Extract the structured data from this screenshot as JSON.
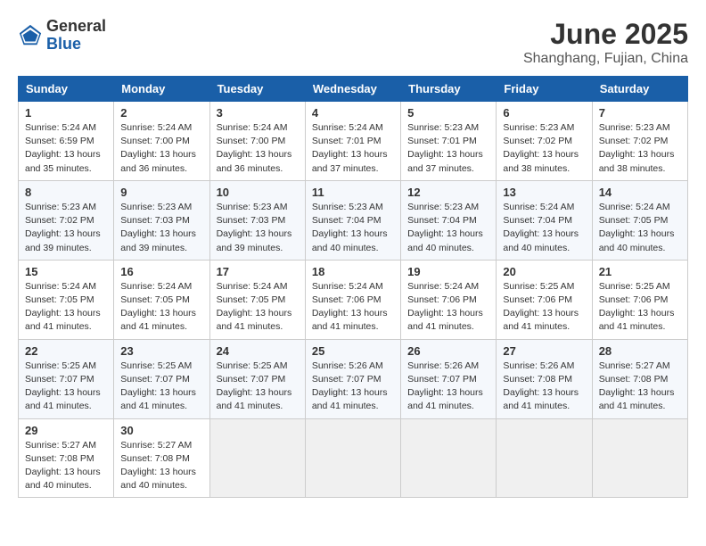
{
  "header": {
    "logo_general": "General",
    "logo_blue": "Blue",
    "month_title": "June 2025",
    "location": "Shanghang, Fujian, China"
  },
  "weekdays": [
    "Sunday",
    "Monday",
    "Tuesday",
    "Wednesday",
    "Thursday",
    "Friday",
    "Saturday"
  ],
  "weeks": [
    [
      {
        "day": "1",
        "sunrise": "5:24 AM",
        "sunset": "6:59 PM",
        "daylight": "13 hours and 35 minutes."
      },
      {
        "day": "2",
        "sunrise": "5:24 AM",
        "sunset": "7:00 PM",
        "daylight": "13 hours and 36 minutes."
      },
      {
        "day": "3",
        "sunrise": "5:24 AM",
        "sunset": "7:00 PM",
        "daylight": "13 hours and 36 minutes."
      },
      {
        "day": "4",
        "sunrise": "5:24 AM",
        "sunset": "7:01 PM",
        "daylight": "13 hours and 37 minutes."
      },
      {
        "day": "5",
        "sunrise": "5:23 AM",
        "sunset": "7:01 PM",
        "daylight": "13 hours and 37 minutes."
      },
      {
        "day": "6",
        "sunrise": "5:23 AM",
        "sunset": "7:02 PM",
        "daylight": "13 hours and 38 minutes."
      },
      {
        "day": "7",
        "sunrise": "5:23 AM",
        "sunset": "7:02 PM",
        "daylight": "13 hours and 38 minutes."
      }
    ],
    [
      {
        "day": "8",
        "sunrise": "5:23 AM",
        "sunset": "7:02 PM",
        "daylight": "13 hours and 39 minutes."
      },
      {
        "day": "9",
        "sunrise": "5:23 AM",
        "sunset": "7:03 PM",
        "daylight": "13 hours and 39 minutes."
      },
      {
        "day": "10",
        "sunrise": "5:23 AM",
        "sunset": "7:03 PM",
        "daylight": "13 hours and 39 minutes."
      },
      {
        "day": "11",
        "sunrise": "5:23 AM",
        "sunset": "7:04 PM",
        "daylight": "13 hours and 40 minutes."
      },
      {
        "day": "12",
        "sunrise": "5:23 AM",
        "sunset": "7:04 PM",
        "daylight": "13 hours and 40 minutes."
      },
      {
        "day": "13",
        "sunrise": "5:24 AM",
        "sunset": "7:04 PM",
        "daylight": "13 hours and 40 minutes."
      },
      {
        "day": "14",
        "sunrise": "5:24 AM",
        "sunset": "7:05 PM",
        "daylight": "13 hours and 40 minutes."
      }
    ],
    [
      {
        "day": "15",
        "sunrise": "5:24 AM",
        "sunset": "7:05 PM",
        "daylight": "13 hours and 41 minutes."
      },
      {
        "day": "16",
        "sunrise": "5:24 AM",
        "sunset": "7:05 PM",
        "daylight": "13 hours and 41 minutes."
      },
      {
        "day": "17",
        "sunrise": "5:24 AM",
        "sunset": "7:05 PM",
        "daylight": "13 hours and 41 minutes."
      },
      {
        "day": "18",
        "sunrise": "5:24 AM",
        "sunset": "7:06 PM",
        "daylight": "13 hours and 41 minutes."
      },
      {
        "day": "19",
        "sunrise": "5:24 AM",
        "sunset": "7:06 PM",
        "daylight": "13 hours and 41 minutes."
      },
      {
        "day": "20",
        "sunrise": "5:25 AM",
        "sunset": "7:06 PM",
        "daylight": "13 hours and 41 minutes."
      },
      {
        "day": "21",
        "sunrise": "5:25 AM",
        "sunset": "7:06 PM",
        "daylight": "13 hours and 41 minutes."
      }
    ],
    [
      {
        "day": "22",
        "sunrise": "5:25 AM",
        "sunset": "7:07 PM",
        "daylight": "13 hours and 41 minutes."
      },
      {
        "day": "23",
        "sunrise": "5:25 AM",
        "sunset": "7:07 PM",
        "daylight": "13 hours and 41 minutes."
      },
      {
        "day": "24",
        "sunrise": "5:25 AM",
        "sunset": "7:07 PM",
        "daylight": "13 hours and 41 minutes."
      },
      {
        "day": "25",
        "sunrise": "5:26 AM",
        "sunset": "7:07 PM",
        "daylight": "13 hours and 41 minutes."
      },
      {
        "day": "26",
        "sunrise": "5:26 AM",
        "sunset": "7:07 PM",
        "daylight": "13 hours and 41 minutes."
      },
      {
        "day": "27",
        "sunrise": "5:26 AM",
        "sunset": "7:08 PM",
        "daylight": "13 hours and 41 minutes."
      },
      {
        "day": "28",
        "sunrise": "5:27 AM",
        "sunset": "7:08 PM",
        "daylight": "13 hours and 41 minutes."
      }
    ],
    [
      {
        "day": "29",
        "sunrise": "5:27 AM",
        "sunset": "7:08 PM",
        "daylight": "13 hours and 40 minutes."
      },
      {
        "day": "30",
        "sunrise": "5:27 AM",
        "sunset": "7:08 PM",
        "daylight": "13 hours and 40 minutes."
      },
      null,
      null,
      null,
      null,
      null
    ]
  ]
}
